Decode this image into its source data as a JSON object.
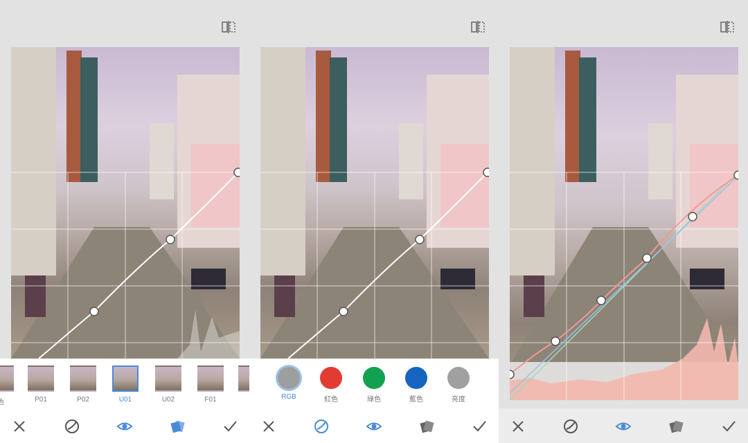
{
  "panels": [
    {
      "presets": [
        {
          "label": "色",
          "selected": false
        },
        {
          "label": "P01",
          "selected": false
        },
        {
          "label": "P02",
          "selected": false
        },
        {
          "label": "U01",
          "selected": true
        },
        {
          "label": "U02",
          "selected": false
        },
        {
          "label": "F01",
          "selected": false
        },
        {
          "label": "F",
          "selected": false
        }
      ]
    },
    {
      "channels": [
        {
          "label": "RGB",
          "color": "#9e9e9e",
          "selected": true
        },
        {
          "label": "紅色",
          "color": "#e23b32",
          "selected": false
        },
        {
          "label": "綠色",
          "color": "#12a150",
          "selected": false
        },
        {
          "label": "藍色",
          "color": "#1565c0",
          "selected": false
        },
        {
          "label": "亮度",
          "color": "#a0a0a0",
          "selected": false
        }
      ]
    },
    {}
  ],
  "toolbar": {
    "icons": [
      "close-icon",
      "curves-icon",
      "eye-icon",
      "presets-icon",
      "check-icon"
    ]
  },
  "colors": {
    "accent": "#4a8ad9",
    "curve": "#ffffff",
    "histogram": "#f3b7ad"
  }
}
